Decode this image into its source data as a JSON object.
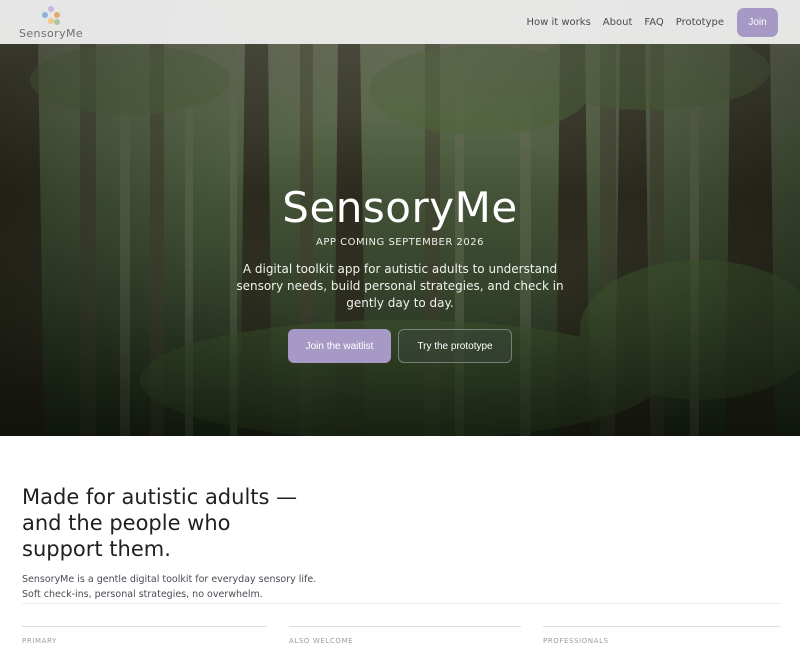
{
  "header": {
    "logo_text": "SensoryMe",
    "nav": [
      "How it works",
      "About",
      "FAQ",
      "Prototype"
    ],
    "join_label": "Join"
  },
  "hero": {
    "title": "SensoryMe",
    "subtitle": "APP COMING SEPTEMBER 2026",
    "description": "A digital toolkit app for autistic adults to understand sensory needs, build personal strategies, and check in gently day to day.",
    "primary_cta": "Join the waitlist",
    "secondary_cta": "Try the prototype"
  },
  "audience": {
    "title": "Made for autistic adults — and the people who support them.",
    "description": "SensoryMe is a gentle digital toolkit for everyday sensory life. Soft check-ins, personal strategies, no overwhelm.",
    "cards": [
      {
        "label": "PRIMARY"
      },
      {
        "label": "ALSO WELCOME"
      },
      {
        "label": "PROFESSIONALS"
      }
    ]
  },
  "colors": {
    "accent": "#a699c6",
    "header_bg": "#ececec",
    "logo_dots": [
      "#e7a774",
      "#8fb0d8",
      "#c9b6dc",
      "#f0c98a",
      "#a7c7a2"
    ]
  }
}
